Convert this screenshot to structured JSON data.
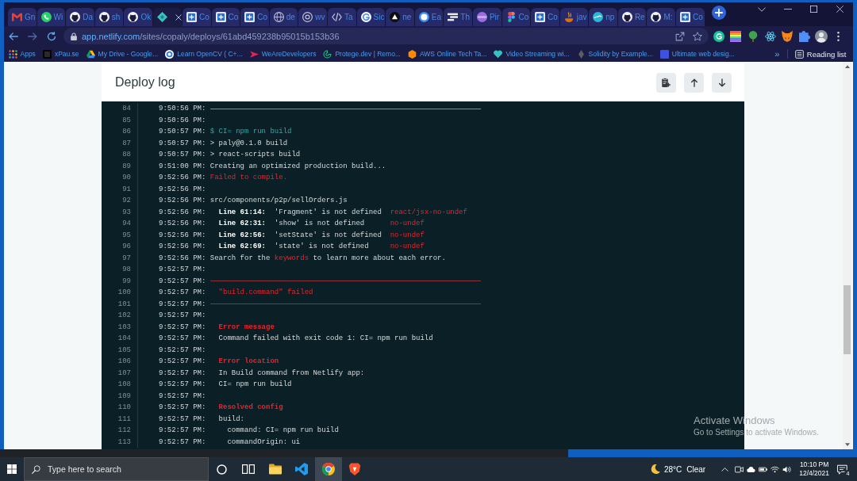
{
  "browser": {
    "tabs": [
      {
        "label": "Gn",
        "kind": "mail",
        "selected": false
      },
      {
        "label": "Wi",
        "kind": "chat",
        "selected": false
      },
      {
        "label": "Da",
        "kind": "github",
        "selected": false
      },
      {
        "label": "sh",
        "kind": "github",
        "selected": false
      },
      {
        "label": "Ok",
        "kind": "github",
        "selected": false
      },
      {
        "kind": "diamond",
        "selected": true
      },
      {
        "label": "Co",
        "kind": "page",
        "selected": false
      },
      {
        "label": "Co",
        "kind": "page",
        "selected": false
      },
      {
        "label": "Co",
        "kind": "page",
        "selected": false
      },
      {
        "label": "de",
        "kind": "globe",
        "selected": false
      },
      {
        "label": "wv",
        "kind": "at",
        "selected": false
      },
      {
        "label": "Ta",
        "kind": "code",
        "selected": false
      },
      {
        "label": "Sic",
        "kind": "gletter",
        "selected": false
      },
      {
        "label": "ne",
        "kind": "triangle",
        "selected": false
      },
      {
        "label": "Ea",
        "kind": "ring",
        "selected": false
      },
      {
        "label": "Th",
        "kind": "stripes",
        "selected": false
      },
      {
        "label": "Pir",
        "kind": "disc",
        "selected": false
      },
      {
        "label": "Co",
        "kind": "shapes",
        "selected": false
      },
      {
        "label": "Co",
        "kind": "page",
        "selected": false
      },
      {
        "label": "jav",
        "kind": "cup",
        "selected": false
      },
      {
        "label": "np",
        "kind": "wave",
        "selected": false
      },
      {
        "label": "Re",
        "kind": "github",
        "selected": false
      },
      {
        "label": "M:",
        "kind": "github",
        "selected": false
      },
      {
        "label": "Co",
        "kind": "page",
        "selected": false
      }
    ],
    "address": {
      "host": "app.netlify.com",
      "path": "/sites/copaly/deploys/61abd459238b95015b153b36"
    },
    "bookmarks": [
      {
        "label": "Apps",
        "kind": "grid"
      },
      {
        "label": "xPau.se",
        "kind": "ptile"
      },
      {
        "label": "My Drive - Google...",
        "kind": "drive"
      },
      {
        "label": "Learn OpenCV ( C+...",
        "kind": "cv"
      },
      {
        "label": "WeAreDevelopers",
        "kind": "chev"
      },
      {
        "label": "Protege.dev | Remo...",
        "kind": "outline"
      },
      {
        "label": "AWS Online Tech Ta...",
        "kind": "hex"
      },
      {
        "label": "Video Streaming wi...",
        "kind": "heart"
      },
      {
        "label": "Solidity by Example...",
        "kind": "gem"
      },
      {
        "label": "Ultimate web desig...",
        "kind": "wtile"
      }
    ],
    "more_bookmarks": "»",
    "reading_list": "Reading list"
  },
  "page": {
    "title": "Deploy log",
    "actions": [
      {
        "kind": "copy"
      },
      {
        "kind": "up"
      },
      {
        "kind": "down"
      }
    ]
  },
  "log": {
    "lines": [
      {
        "number": "84",
        "time": "9:50:56 PM:",
        "kind": "divider",
        "color": "#2bb4b6"
      },
      {
        "number": "85",
        "time": "9:50:56 PM:",
        "kind": "text"
      },
      {
        "number": "86",
        "time": "9:50:57 PM:",
        "kind": "text",
        "parts": [
          {
            "text": "$ CI= npm run build",
            "kind": "command"
          }
        ]
      },
      {
        "number": "87",
        "time": "9:50:57 PM:",
        "kind": "text",
        "parts": [
          {
            "text": "> paly@0.1.0 build",
            "kind": "text"
          }
        ]
      },
      {
        "number": "88",
        "time": "9:50:57 PM:",
        "kind": "text",
        "parts": [
          {
            "text": "> react-scripts build",
            "kind": "text"
          }
        ]
      },
      {
        "number": "89",
        "time": "9:51:00 PM:",
        "kind": "text",
        "parts": [
          {
            "text": "Creating an optimized production build...",
            "kind": "text"
          }
        ]
      },
      {
        "number": "90",
        "time": "9:52:56 PM:",
        "kind": "text",
        "parts": [
          {
            "text": "Failed to compile.",
            "kind": "error"
          }
        ]
      },
      {
        "number": "91",
        "time": "9:52:56 PM:",
        "kind": "text"
      },
      {
        "number": "92",
        "time": "9:52:56 PM:",
        "kind": "text",
        "parts": [
          {
            "text": "src/components/p2p/sellOrders.js",
            "kind": "text"
          }
        ]
      },
      {
        "number": "93",
        "time": "9:52:56 PM:",
        "kind": "text",
        "parts": [
          {
            "text": "  Line 61:14:",
            "kind": "position"
          },
          {
            "text": "  'Fragment' is not defined  ",
            "kind": "text"
          },
          {
            "text": "react/jsx-no-undef",
            "kind": "error"
          }
        ]
      },
      {
        "number": "94",
        "time": "9:52:56 PM:",
        "kind": "text",
        "parts": [
          {
            "text": "  Line 62:31:",
            "kind": "position"
          },
          {
            "text": "  'show' is not defined      ",
            "kind": "text"
          },
          {
            "text": "no-undef",
            "kind": "error"
          }
        ]
      },
      {
        "number": "95",
        "time": "9:52:56 PM:",
        "kind": "text",
        "parts": [
          {
            "text": "  Line 62:56:",
            "kind": "position"
          },
          {
            "text": "  'setState' is not defined  ",
            "kind": "text"
          },
          {
            "text": "no-undef",
            "kind": "error"
          }
        ]
      },
      {
        "number": "96",
        "time": "9:52:56 PM:",
        "kind": "text",
        "parts": [
          {
            "text": "  Line 62:69:",
            "kind": "position"
          },
          {
            "text": "  'state' is not defined     ",
            "kind": "text"
          },
          {
            "text": "no-undef",
            "kind": "error"
          }
        ]
      },
      {
        "number": "97",
        "time": "9:52:56 PM:",
        "kind": "text",
        "parts": [
          {
            "text": "Search for the ",
            "kind": "text"
          },
          {
            "text": "keywords",
            "kind": "error"
          },
          {
            "text": " to learn more about each error.",
            "kind": "text"
          }
        ]
      },
      {
        "number": "98",
        "time": "9:52:57 PM:",
        "kind": "text"
      },
      {
        "number": "99",
        "time": "9:52:57 PM:",
        "kind": "divider",
        "color": "#8e2f36"
      },
      {
        "number": "100",
        "time": "9:52:57 PM:",
        "kind": "text",
        "parts": [
          {
            "text": "  \"build.command\" failed",
            "kind": "error"
          }
        ]
      },
      {
        "number": "101",
        "time": "9:52:57 PM:",
        "kind": "divider",
        "color": "#8e2f36"
      },
      {
        "number": "102",
        "time": "9:52:57 PM:",
        "kind": "text"
      },
      {
        "number": "103",
        "time": "9:52:57 PM:",
        "kind": "text",
        "parts": [
          {
            "text": "  Error message",
            "kind": "heading"
          }
        ]
      },
      {
        "number": "104",
        "time": "9:52:57 PM:",
        "kind": "text",
        "parts": [
          {
            "text": "  Command failed with exit code 1: CI= npm run build",
            "kind": "text"
          }
        ]
      },
      {
        "number": "105",
        "time": "9:52:57 PM:",
        "kind": "text"
      },
      {
        "number": "106",
        "time": "9:52:57 PM:",
        "kind": "text",
        "parts": [
          {
            "text": "  Error location",
            "kind": "heading"
          }
        ]
      },
      {
        "number": "107",
        "time": "9:52:57 PM:",
        "kind": "text",
        "parts": [
          {
            "text": "  In Build command from Netlify app:",
            "kind": "text"
          }
        ]
      },
      {
        "number": "108",
        "time": "9:52:57 PM:",
        "kind": "text",
        "parts": [
          {
            "text": "  CI= npm run build",
            "kind": "text"
          }
        ]
      },
      {
        "number": "109",
        "time": "9:52:57 PM:",
        "kind": "text"
      },
      {
        "number": "110",
        "time": "9:52:57 PM:",
        "kind": "text",
        "parts": [
          {
            "text": "  Resolved config",
            "kind": "heading"
          }
        ]
      },
      {
        "number": "111",
        "time": "9:52:57 PM:",
        "kind": "text",
        "parts": [
          {
            "text": "  build:",
            "kind": "text"
          }
        ]
      },
      {
        "number": "112",
        "time": "9:52:57 PM:",
        "kind": "text",
        "parts": [
          {
            "text": "    command: CI= npm run build",
            "kind": "text"
          }
        ]
      },
      {
        "number": "113",
        "time": "9:52:57 PM:",
        "kind": "text",
        "parts": [
          {
            "text": "    commandOrigin: ui",
            "kind": "text"
          }
        ]
      }
    ]
  },
  "activation_notice": {
    "title": "Activate Windows",
    "message": "Go to Settings to activate Windows."
  },
  "taskbar": {
    "search": {
      "placeholder": "Type here to search"
    },
    "apps": [
      {
        "kind": "explorer",
        "selected": false
      },
      {
        "kind": "vscode",
        "selected": false
      },
      {
        "kind": "chrome",
        "selected": true
      },
      {
        "kind": "brave",
        "selected": false
      }
    ],
    "weather": {
      "temperature": "28°C",
      "condition": "Clear"
    },
    "clock": {
      "time": "10:10 PM",
      "date": "12/4/2021"
    },
    "notifications": "4"
  }
}
